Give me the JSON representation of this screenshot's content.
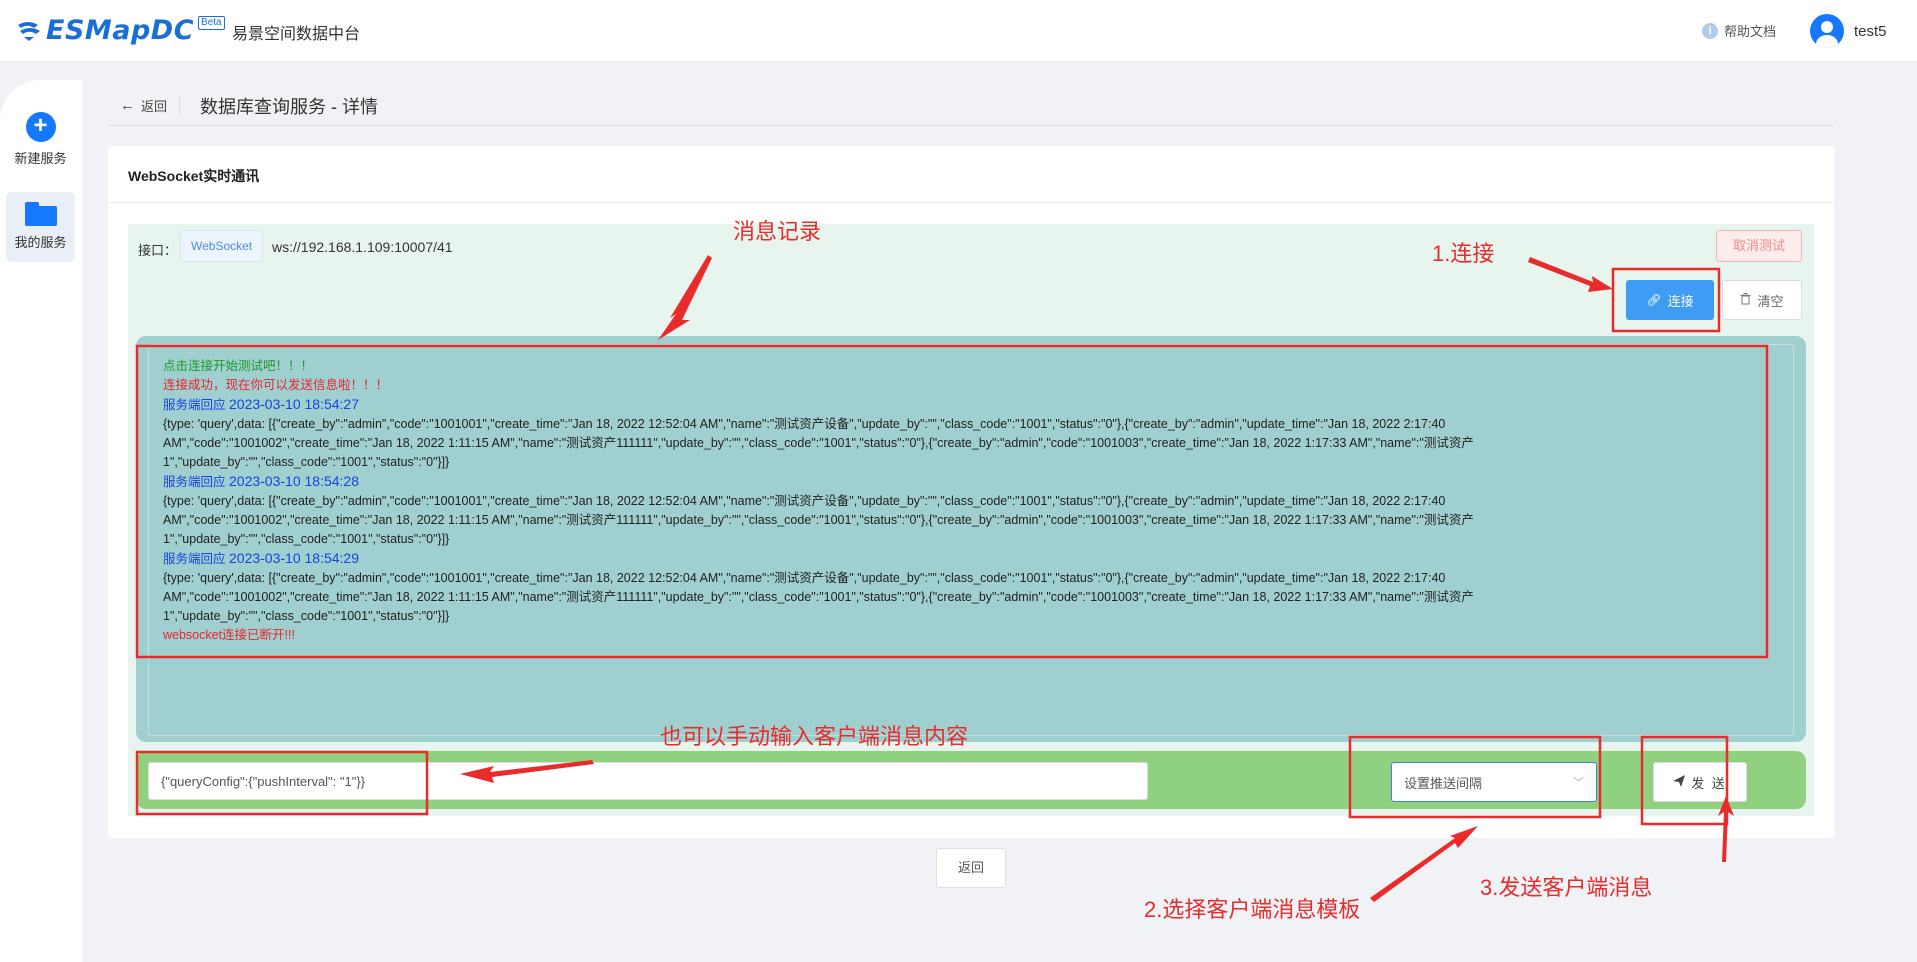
{
  "header": {
    "logo_text": "ESMapDC",
    "logo_badge": "Beta",
    "app_title": "易景空间数据中台",
    "help_label": "帮助文档",
    "username": "test5"
  },
  "sidebar": {
    "items": [
      {
        "label": "新建服务",
        "icon": "plus-icon"
      },
      {
        "label": "我的服务",
        "icon": "folder-icon"
      }
    ]
  },
  "breadcrumb": {
    "back_label": "返回",
    "page_title": "数据库查询服务 - 详情"
  },
  "card": {
    "title": "WebSocket实时通讯",
    "interface_label": "接口：",
    "interface_tag": "WebSocket",
    "interface_url": "ws://192.168.1.109:10007/41",
    "cancel_label": "取消测试",
    "connect_label": "连接",
    "clear_label": "清空"
  },
  "log": {
    "start_hint": "点击连接开始测试吧！！！",
    "connected": "连接成功，现在你可以发送信息啦！！！",
    "responses": [
      {
        "title": "服务端回应",
        "timestamp": "2023-03-10 18:54:27",
        "lines": [
          "{type: 'query',data: [{\"create_by\":\"admin\",\"code\":\"1001001\",\"create_time\":\"Jan 18, 2022 12:52:04 AM\",\"name\":\"测试资产设备\",\"update_by\":\"\",\"class_code\":\"1001\",\"status\":\"0\"},{\"create_by\":\"admin\",\"update_time\":\"Jan 18, 2022 2:17:40",
          "AM\",\"code\":\"1001002\",\"create_time\":\"Jan 18, 2022 1:11:15 AM\",\"name\":\"测试资产111111\",\"update_by\":\"\",\"class_code\":\"1001\",\"status\":\"0\"},{\"create_by\":\"admin\",\"code\":\"1001003\",\"create_time\":\"Jan 18, 2022 1:17:33 AM\",\"name\":\"测试资产",
          "1\",\"update_by\":\"\",\"class_code\":\"1001\",\"status\":\"0\"}]}"
        ]
      },
      {
        "title": "服务端回应",
        "timestamp": "2023-03-10 18:54:28",
        "lines": [
          "{type: 'query',data: [{\"create_by\":\"admin\",\"code\":\"1001001\",\"create_time\":\"Jan 18, 2022 12:52:04 AM\",\"name\":\"测试资产设备\",\"update_by\":\"\",\"class_code\":\"1001\",\"status\":\"0\"},{\"create_by\":\"admin\",\"update_time\":\"Jan 18, 2022 2:17:40",
          "AM\",\"code\":\"1001002\",\"create_time\":\"Jan 18, 2022 1:11:15 AM\",\"name\":\"测试资产111111\",\"update_by\":\"\",\"class_code\":\"1001\",\"status\":\"0\"},{\"create_by\":\"admin\",\"code\":\"1001003\",\"create_time\":\"Jan 18, 2022 1:17:33 AM\",\"name\":\"测试资产",
          "1\",\"update_by\":\"\",\"class_code\":\"1001\",\"status\":\"0\"}]}"
        ]
      },
      {
        "title": "服务端回应",
        "timestamp": "2023-03-10 18:54:29",
        "lines": [
          "{type: 'query',data: [{\"create_by\":\"admin\",\"code\":\"1001001\",\"create_time\":\"Jan 18, 2022 12:52:04 AM\",\"name\":\"测试资产设备\",\"update_by\":\"\",\"class_code\":\"1001\",\"status\":\"0\"},{\"create_by\":\"admin\",\"update_time\":\"Jan 18, 2022 2:17:40",
          "AM\",\"code\":\"1001002\",\"create_time\":\"Jan 18, 2022 1:11:15 AM\",\"name\":\"测试资产111111\",\"update_by\":\"\",\"class_code\":\"1001\",\"status\":\"0\"},{\"create_by\":\"admin\",\"code\":\"1001003\",\"create_time\":\"Jan 18, 2022 1:17:33 AM\",\"name\":\"测试资产",
          "1\",\"update_by\":\"\",\"class_code\":\"1001\",\"status\":\"0\"}]}"
        ]
      }
    ],
    "disconnected": "websocket连接已断开!!!"
  },
  "send": {
    "input_value": "{\"queryConfig\":{\"pushInterval\": \"1\"}}",
    "select_value": "设置推送间隔",
    "send_label": "发 送"
  },
  "footer": {
    "back_label": "返回"
  },
  "annotations": {
    "message_log": "消息记录",
    "connect_step": "1.连接",
    "manual_input": "也可以手动输入客户端消息内容",
    "select_template": "2.选择客户端消息模板",
    "send_message": "3.发送客户端消息"
  },
  "colors": {
    "brand": "#1a6fd6",
    "primary": "#3f9cf5",
    "log_bg": "#a0cfd0",
    "send_bar_bg": "#8fd17e",
    "annotation_red": "#ea2b2b",
    "log_green": "#1d9a2a",
    "log_red": "#e8242d",
    "log_blue": "#1843e0"
  }
}
